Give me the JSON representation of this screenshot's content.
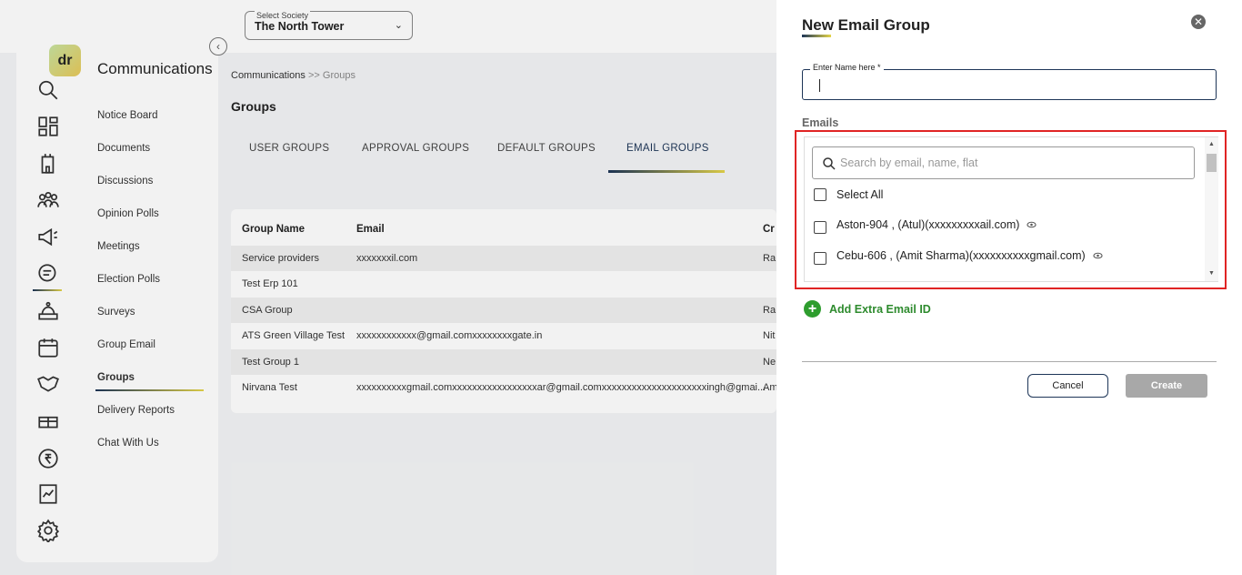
{
  "society": {
    "label": "Select Society",
    "value": "The North Tower"
  },
  "subnav": {
    "title": "Communications",
    "items": [
      {
        "label": "Notice Board"
      },
      {
        "label": "Documents"
      },
      {
        "label": "Discussions"
      },
      {
        "label": "Opinion Polls"
      },
      {
        "label": "Meetings"
      },
      {
        "label": "Election Polls"
      },
      {
        "label": "Surveys"
      },
      {
        "label": "Group Email"
      },
      {
        "label": "Groups",
        "active": true
      },
      {
        "label": "Delivery Reports"
      },
      {
        "label": "Chat With Us"
      }
    ]
  },
  "rail_icons": [
    "search-icon",
    "dashboard-icon",
    "building-icon",
    "people-icon",
    "megaphone-icon",
    "chat-icon",
    "reception-icon",
    "calendar-icon",
    "handshake-icon",
    "gift-icon",
    "rupee-icon",
    "chart-icon",
    "settings-icon"
  ],
  "breadcrumb": {
    "root": "Communications",
    "sep": ">>",
    "current": "Groups"
  },
  "page_title": "Groups",
  "tabs": [
    {
      "label": "USER GROUPS"
    },
    {
      "label": "APPROVAL GROUPS"
    },
    {
      "label": "DEFAULT GROUPS"
    },
    {
      "label": "EMAIL GROUPS",
      "active": true
    }
  ],
  "table": {
    "headers": [
      "Group Name",
      "Email",
      "Cr"
    ],
    "rows": [
      [
        "Service providers",
        "xxxxxxxil.com",
        "Ra"
      ],
      [
        "Test Erp 101",
        "",
        ""
      ],
      [
        "CSA Group",
        "",
        "Ra"
      ],
      [
        "ATS Green Village Test",
        "xxxxxxxxxxxx@gmail.comxxxxxxxxgate.in",
        "Nit"
      ],
      [
        "Test Group 1",
        "",
        "Ne"
      ],
      [
        "Nirvana Test",
        "xxxxxxxxxxgmail.comxxxxxxxxxxxxxxxxxar@gmail.comxxxxxxxxxxxxxxxxxxxxxingh@gmai...",
        "Am"
      ]
    ]
  },
  "drawer": {
    "title": "New Email Group",
    "name_field_label": "Enter Name here *",
    "name_value": "",
    "emails_label": "Emails",
    "search_placeholder": "Search by email, name, flat",
    "select_all": "Select All",
    "options": [
      "Aston-904 , (Atul)(xxxxxxxxxail.com)",
      "Cebu-606 , (Amit Sharma)(xxxxxxxxxxgmail.com)"
    ],
    "add_extra": "Add Extra Email ID",
    "cancel": "Cancel",
    "create": "Create",
    "close": "✕",
    "highlight_color": "#e02424"
  }
}
